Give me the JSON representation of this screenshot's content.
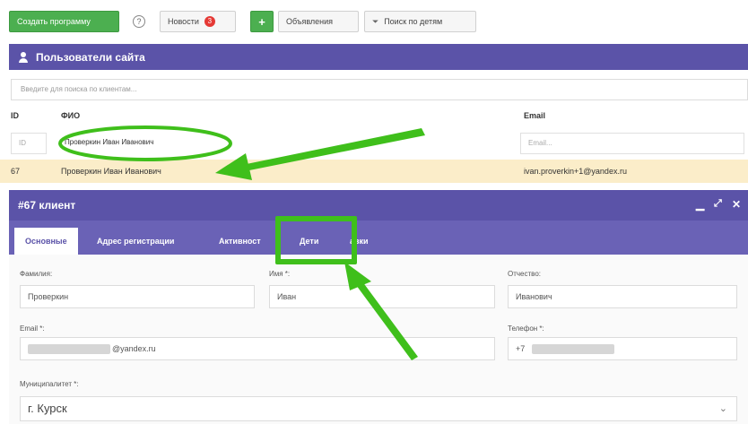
{
  "toolbar": {
    "create_program": "Создать программу",
    "news": "Новости",
    "news_count": "3",
    "ads": "Объявления",
    "search_children": "Поиск по детям"
  },
  "users_panel": {
    "title": "Пользователи сайта",
    "search_placeholder": "Введите для поиска по клиентам...",
    "col_id": "ID",
    "col_name": "ФИО",
    "col_email": "Email",
    "filter_id_placeholder": "ID",
    "filter_email_placeholder": "Email...",
    "filter_name_value": "Проверкин Иван Иванович",
    "row": {
      "id": "67",
      "name": "Проверкин Иван Иванович",
      "email": "ivan.proverkin+1@yandex.ru"
    }
  },
  "client_dialog": {
    "title": "#67 клиент",
    "tabs": [
      "Основные",
      "Адрес регистрации",
      "Активност",
      "Дети",
      "авки"
    ],
    "active_tab": "Основные",
    "fields": {
      "lastname_label": "Фамилия:",
      "lastname_value": "Проверкин",
      "firstname_label": "Имя *:",
      "firstname_value": "Иван",
      "patronymic_label": "Отчество:",
      "patronymic_value": "Иванович",
      "email_label": "Email *:",
      "email_value": "@yandex.ru",
      "phone_label": "Телефон *:",
      "phone_value": "+7",
      "municipality_label": "Муниципалитет *:",
      "municipality_value": "г. Курск"
    }
  },
  "colors": {
    "header_purple": "#5b53a8",
    "green_accent": "#3fbf1b",
    "highlight_row": "#fbedc9"
  },
  "icons": [
    "help-icon",
    "plus-icon",
    "filter-icon",
    "user-icon",
    "minimize-icon",
    "expand-icon",
    "close-icon",
    "chevron-down-icon"
  ]
}
